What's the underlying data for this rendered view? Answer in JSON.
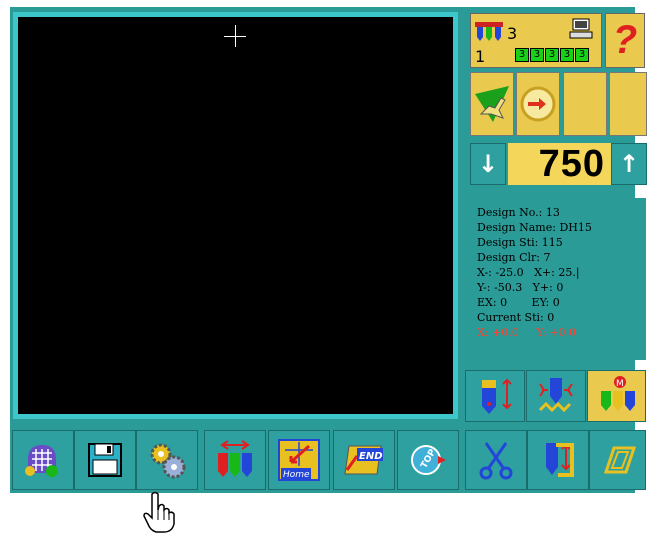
{
  "status": {
    "color_count": "3",
    "needle": "1",
    "bobbins": [
      "3",
      "3",
      "3",
      "3",
      "3"
    ]
  },
  "help": {
    "label": "?"
  },
  "speed": {
    "down_label": "↓",
    "value": "750",
    "up_label": "↑"
  },
  "design_info": {
    "rows": [
      {
        "label": "Design No.:",
        "value": "13"
      },
      {
        "label": "Design Name:",
        "value": "DH15"
      },
      {
        "label": "Design Sti:",
        "value": "115"
      },
      {
        "label": "Design Clr:",
        "value": "7"
      },
      {
        "label": "X-:",
        "value": "-25.0   X+: 25.|"
      },
      {
        "label": "Y-:",
        "value": "-50.3   Y+: 0"
      },
      {
        "label": "EX:",
        "value": "0       EY: 0"
      },
      {
        "label": "Current Sti:",
        "value": "0"
      }
    ],
    "position": "X: +0.0     Y: +0.0"
  },
  "toolbar": {
    "home_label": "Home",
    "end_label": "END",
    "top_label": "TOP"
  },
  "colors": {
    "panel": "#2a9b97",
    "button": "#2ea0a0",
    "accent": "#eaca4e",
    "canvas": "#000000"
  }
}
